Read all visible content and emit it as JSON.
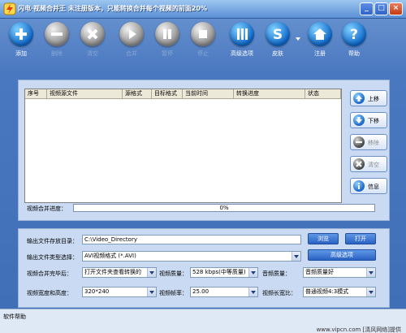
{
  "window": {
    "title": "闪电·视频合并王  未注册版本，只能转换合并每个视频的前面20%",
    "controls": [
      "_",
      "□",
      "×"
    ]
  },
  "toolbar": {
    "items": [
      {
        "label": "添加",
        "icon": "plus-icon",
        "enabled": true
      },
      {
        "label": "删除",
        "icon": "minus-icon",
        "enabled": false
      },
      {
        "label": "清空",
        "icon": "x-icon",
        "enabled": false
      },
      {
        "label": "合并",
        "icon": "play-icon",
        "enabled": false
      },
      {
        "label": "暂停",
        "icon": "pause-icon",
        "enabled": false
      },
      {
        "label": "停止",
        "icon": "stop-icon",
        "enabled": false
      },
      {
        "label": "高级选项",
        "icon": "tools-icon",
        "enabled": true
      },
      {
        "label": "皮肤",
        "icon": "skin-icon",
        "enabled": true
      },
      {
        "label": "注册",
        "icon": "home-icon",
        "enabled": true
      },
      {
        "label": "帮助",
        "icon": "help-icon",
        "enabled": true
      }
    ]
  },
  "list": {
    "columns": [
      "序号",
      "视频源文件",
      "源格式",
      "目标格式",
      "当前时间",
      "转换进度",
      "状态"
    ]
  },
  "side_buttons": {
    "up": "上移",
    "down": "下移",
    "remove": "移除",
    "clear": "清空",
    "info": "信息"
  },
  "progress": {
    "label": "视频合并进度：",
    "value": 0,
    "text": "0%"
  },
  "settings": {
    "output_dir_label": "输出文件存放目录：",
    "output_dir_value": "C:\\Video_Directory",
    "browse_label": "浏览",
    "open_label": "打开",
    "output_type_label": "输出文件类型选择：",
    "output_type_value": "AVI视频格式 (*.AVI)",
    "advanced_label": "高级选项",
    "after_merge_label": "视频合并完毕后：",
    "after_merge_value": "打开文件夹查看转换的",
    "video_quality_label": "视频质量：",
    "video_quality_value": "528 kbps(中等质量)",
    "audio_quality_label": "音频质量：",
    "audio_quality_value": "音频质量好",
    "size_label": "视频宽度和高度：",
    "size_value": "320*240",
    "fps_label": "视频帧率：",
    "fps_value": "25.00",
    "aspect_label": "视频长宽比：",
    "aspect_value": "普通视频4:3模式"
  },
  "status": {
    "text": "软件帮助",
    "watermark": "www.vipcn.com [清风网络]提供"
  }
}
